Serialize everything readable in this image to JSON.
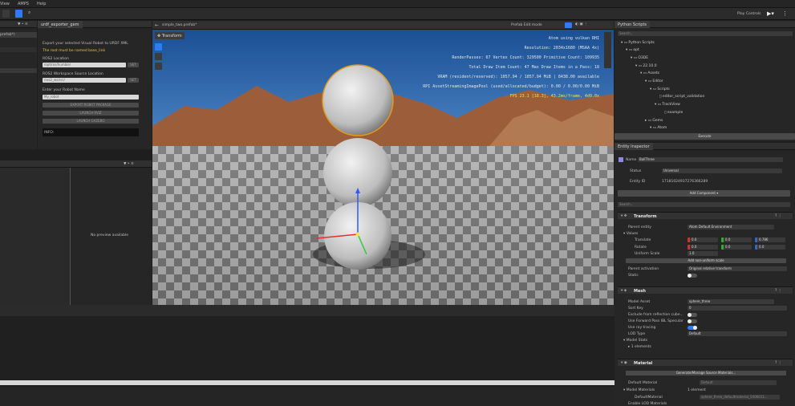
{
  "menu": {
    "view": "View",
    "amps": "AMPS",
    "help": "Help"
  },
  "toolbar": {
    "play_controls": "Play Controls"
  },
  "urdf": {
    "tab": "urdf_exporter_gem",
    "desc": "Export your selected Visual Robot to URDF XML",
    "warn": "The root must be named base_link",
    "loc_label": "ROS2 Location",
    "loc_value": "/opt/ros/humble/",
    "set": "SET",
    "ws_label": "ROS2 Workspace Source Location",
    "ws_value": "/ros2_ws/src/",
    "name_label": "Enter your Robot Name",
    "name_value": "My_robot",
    "export": "EXPORT ROBOT PACKAGE",
    "launch1": "LAUNCH RVIZ",
    "launch2": "LAUNCH GAZEBO",
    "info": "INFO:"
  },
  "outliner": {
    "item": "prefab*)"
  },
  "preview": {
    "text": "No preview available"
  },
  "viewport": {
    "tab": "simple_two.prefab*",
    "mode": "Prefab Edit mode",
    "transform_btn": "Transform",
    "hud": [
      "Atom using vulkan RHI",
      "Resolution: 2034x1680 (MSAA 4x)",
      "RenderPasses: 67 Vertex Count: 329500 Primitive Count: 109935",
      "Total Draw Item Count: 47  Max Draw Items in a Pass: 18",
      "VRAM (resident/reserved): 1057.94 / 1857.94 MiB | 8438.00 available",
      "RPI AssetStreamingImagePool (used/allocated/budget): 0.00 / 0.00/0.00 MiB",
      "FPS 23.1 [18.3], 43.2ms/frame, 4d9.0x"
    ]
  },
  "python": {
    "tab": "Python Scripts",
    "search": "Search...",
    "items": [
      "Python Scripts",
      "opt",
      "O3DE",
      "22.10.0",
      "Assets",
      "Editor",
      "Scripts",
      "editor_script_validation",
      "TrackView",
      "example",
      "Gems",
      "Atom"
    ],
    "execute": "Execute"
  },
  "inspector": {
    "tab": "Entity Inspector",
    "name_label": "Name",
    "name": "BallThree",
    "status_label": "Status",
    "status": "Universal",
    "id_label": "Entity ID",
    "id": "17181024937276366289",
    "add_component": "Add Component ▾",
    "search": "Search...",
    "transform": {
      "title": "Transform",
      "parent_label": "Parent entity",
      "parent": "Atom Default Environment",
      "values": "Values",
      "translate": "Translate",
      "t": [
        "0.0",
        "0.0",
        "0.786"
      ],
      "rotate": "Rotate",
      "r": [
        "0.0",
        "0.0",
        "0.0"
      ],
      "uscale": "Uniform Scale",
      "scale": "1.0",
      "add_nonuniform": "Add non-uniform scale",
      "pact_label": "Parent activation",
      "pact": "Original relative transform",
      "static": "Static"
    },
    "mesh": {
      "title": "Mesh",
      "model_label": "Model Asset",
      "model": "sphere_three",
      "sort_label": "Sort Key",
      "sort": "0",
      "excl": "Exclude from reflection cube...",
      "fwd": "Use Forward Pass IBL Specular",
      "ray": "Use ray tracing",
      "lod_label": "LOD Type",
      "lod": "Default",
      "stats": "Model Stats",
      "elements": "1 elements"
    },
    "material": {
      "title": "Material",
      "gen": "Generate/Manage Source Materials...",
      "def_label": "Default Material",
      "def": "Default",
      "models_label": "Model Materials",
      "models_count": "1 element",
      "dm_label": "DefaultMaterial",
      "dm": "sphere_three_defaultmaterial_5406011...",
      "enable_lod": "Enable LOD Materials"
    }
  },
  "colors": {
    "accent": "#2f7cf0",
    "panel": "#262626",
    "sky": "#1f5ea8",
    "hud_fps": "#f0e44a"
  }
}
